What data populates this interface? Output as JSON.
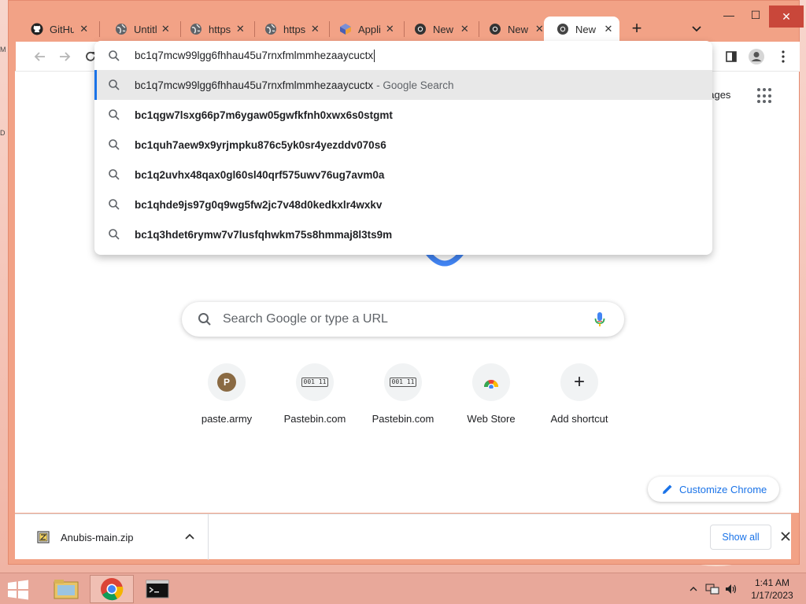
{
  "window": {
    "tabs": [
      {
        "title": "GitHu",
        "icon": "github-icon"
      },
      {
        "title": "Untitl",
        "icon": "globe-icon"
      },
      {
        "title": "https:",
        "icon": "globe-icon"
      },
      {
        "title": "https:",
        "icon": "globe-icon"
      },
      {
        "title": "Applic",
        "icon": "app-cube-icon"
      },
      {
        "title": "New T",
        "icon": "chrome-icon"
      },
      {
        "title": "New",
        "icon": "chrome-icon"
      },
      {
        "title": "New",
        "icon": "chrome-icon",
        "active": true
      }
    ],
    "new_tab_label": "+",
    "close_tab_label": "✕",
    "controls": {
      "minimize": "—",
      "maximize": "☐",
      "close": "✕"
    }
  },
  "omnibox": {
    "value": "bc1q7mcw99lgg6fhhau45u7rnxfmlmmhezaaycuctx",
    "suggestions": [
      {
        "text": "bc1q7mcw99lgg6fhhau45u7rnxfmlmmhezaaycuctx",
        "suffix": "- Google Search"
      },
      {
        "text": "bc1qgw7lsxg66p7m6ygaw05gwfkfnh0xwx6s0stgmt"
      },
      {
        "text": "bc1quh7aew9x9yrjmpku876c5yk0sr4yezddv070s6"
      },
      {
        "text": "bc1q2uvhx48qax0gl60sl40qrf575uwv76ug7avm0a"
      },
      {
        "text": "bc1qhde9js97g0q9wg5fw2jc7v48d0kedkxlr4wxkv"
      },
      {
        "text": "bc1q3hdet6rymw7v7lusfqhwkm75s8hmmaj8l3ts9m"
      }
    ]
  },
  "page": {
    "images_link": "nages",
    "search_placeholder": "Search Google or type a URL",
    "shortcuts": [
      {
        "label": "paste.army",
        "icon": "P"
      },
      {
        "label": "Pastebin.com",
        "icon": "001 11"
      },
      {
        "label": "Pastebin.com",
        "icon": "001 11"
      },
      {
        "label": "Web Store",
        "icon": "webstore-icon"
      },
      {
        "label": "Add shortcut",
        "icon": "+"
      }
    ],
    "customize_label": "Customize Chrome"
  },
  "downloads": {
    "filename": "Anubis-main.zip",
    "show_all": "Show all"
  },
  "taskbar": {
    "time": "1:41 AM",
    "date": "1/17/2023"
  },
  "colors": {
    "titlebar": "#f2a286",
    "accent": "#1a73e8",
    "taskbar": "#e8a89a",
    "close_red": "#c9473a"
  }
}
